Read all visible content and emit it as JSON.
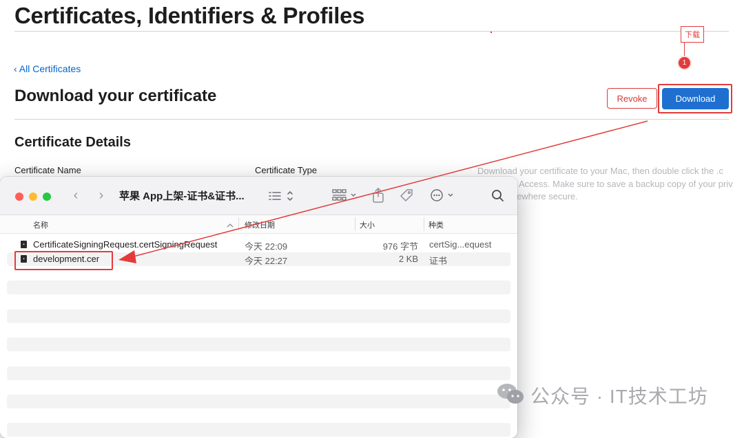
{
  "page": {
    "title": "Certificates, Identifiers & Profiles",
    "back_link": "‹ All Certificates",
    "section_title": "Download your certificate",
    "revoke_label": "Revoke",
    "download_label": "Download",
    "details_title": "Certificate Details",
    "certificate_name_label": "Certificate Name",
    "certificate_type_label": "Certificate Type",
    "hint_lines": [
      "Download your certificate to your Mac, then double click the .c",
      "Access. Make sure to save a backup copy of your priv",
      "ewhere secure."
    ]
  },
  "annotation": {
    "callout_text": "下载",
    "badge_number": "1"
  },
  "finder": {
    "title": "苹果 App上架-证书&证书...",
    "columns": {
      "name": "名称",
      "modified": "修改日期",
      "size": "大小",
      "kind": "种类"
    },
    "files": [
      {
        "name": "CertificateSigningRequest.certSigningRequest",
        "modified": "今天 22:09",
        "size": "976 字节",
        "kind": "certSig...equest"
      },
      {
        "name": "development.cer",
        "modified": "今天 22:27",
        "size": "2 KB",
        "kind": "证书"
      }
    ]
  },
  "watermark": {
    "text": "公众号 · IT技术工坊"
  },
  "colors": {
    "accent_blue": "#1f6fd0",
    "annotation_red": "#e23b3b",
    "link_blue": "#0066cc"
  }
}
